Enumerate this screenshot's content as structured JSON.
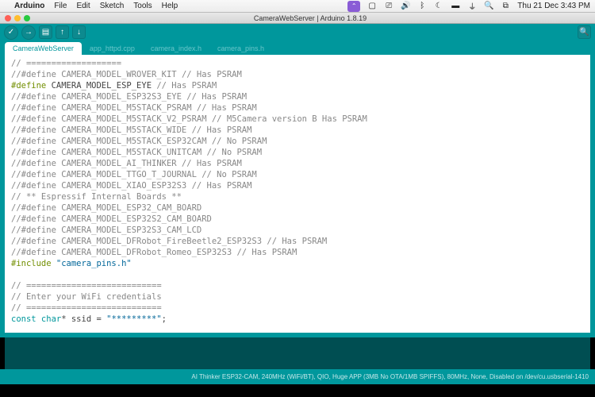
{
  "menubar": {
    "apple": "",
    "app": "Arduino",
    "items": [
      "File",
      "Edit",
      "Sketch",
      "Tools",
      "Help"
    ],
    "clock": "Thu 21 Dec  3:43 PM",
    "purple_badge": "⌃"
  },
  "window": {
    "title": "CameraWebServer | Arduino 1.8.19"
  },
  "tabs": [
    "CameraWebServer",
    "app_httpd.cpp",
    "camera_index.h",
    "camera_pins.h"
  ],
  "code": {
    "l0": "// ===================",
    "l1_a": "//#define CAMERA_MODEL_WROVER_KIT ",
    "l1_b": "// Has PSRAM",
    "l2_a": "#define",
    "l2_b": " CAMERA_MODEL_ESP_EYE ",
    "l2_c": "// Has PSRAM",
    "l3": "//#define CAMERA_MODEL_ESP32S3_EYE // Has PSRAM",
    "l4": "//#define CAMERA_MODEL_M5STACK_PSRAM // Has PSRAM",
    "l5": "//#define CAMERA_MODEL_M5STACK_V2_PSRAM // M5Camera version B Has PSRAM",
    "l6": "//#define CAMERA_MODEL_M5STACK_WIDE // Has PSRAM",
    "l7": "//#define CAMERA_MODEL_M5STACK_ESP32CAM // No PSRAM",
    "l8": "//#define CAMERA_MODEL_M5STACK_UNITCAM // No PSRAM",
    "l9": "//#define CAMERA_MODEL_AI_THINKER // Has PSRAM",
    "l10": "//#define CAMERA_MODEL_TTGO_T_JOURNAL // No PSRAM",
    "l11": "//#define CAMERA_MODEL_XIAO_ESP32S3 // Has PSRAM",
    "l12": "// ** Espressif Internal Boards **",
    "l13": "//#define CAMERA_MODEL_ESP32_CAM_BOARD",
    "l14": "//#define CAMERA_MODEL_ESP32S2_CAM_BOARD",
    "l15": "//#define CAMERA_MODEL_ESP32S3_CAM_LCD",
    "l16": "//#define CAMERA_MODEL_DFRobot_FireBeetle2_ESP32S3 // Has PSRAM",
    "l17": "//#define CAMERA_MODEL_DFRobot_Romeo_ESP32S3 // Has PSRAM",
    "l18_a": "#include",
    "l18_b": " \"camera_pins.h\"",
    "l19": "",
    "l20": "// ===========================",
    "l21": "// Enter your WiFi credentials",
    "l22": "// ===========================",
    "l23_a": "const",
    "l23_b": " char",
    "l23_c": "* ssid = ",
    "l23_d": "\"*********\"",
    "l23_e": ";"
  },
  "status": {
    "left": "",
    "right": "AI Thinker ESP32-CAM, 240MHz (WiFi/BT), QIO, Huge APP (3MB No OTA/1MB SPIFFS), 80MHz, None, Disabled on /dev/cu.usbserial-1410"
  }
}
